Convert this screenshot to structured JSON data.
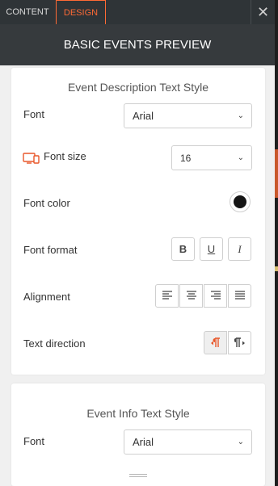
{
  "tabs": {
    "content_label": "CONTENT",
    "design_label": "DESIGN"
  },
  "close_glyph": "✕",
  "header": {
    "title": "BASIC EVENTS PREVIEW"
  },
  "description_style": {
    "title": "Event Description Text Style",
    "font": {
      "label": "Font",
      "value": "Arial"
    },
    "font_size": {
      "label": "Font size",
      "value": "16",
      "icon": "responsive-devices-icon"
    },
    "font_color": {
      "label": "Font color",
      "value": "#151515"
    },
    "font_format": {
      "label": "Font format",
      "bold": "B",
      "underline": "U",
      "italic": "I"
    },
    "alignment": {
      "label": "Alignment",
      "options": [
        "align-left",
        "align-center",
        "align-right",
        "align-justify"
      ]
    },
    "text_direction": {
      "label": "Text direction",
      "active": "ltr"
    }
  },
  "info_style": {
    "title": "Event Info Text Style",
    "font": {
      "label": "Font",
      "value": "Arial"
    }
  },
  "colors": {
    "accent": "#ff6a35",
    "header_bg": "#363a3d",
    "tabs_bg": "#2f3437"
  }
}
